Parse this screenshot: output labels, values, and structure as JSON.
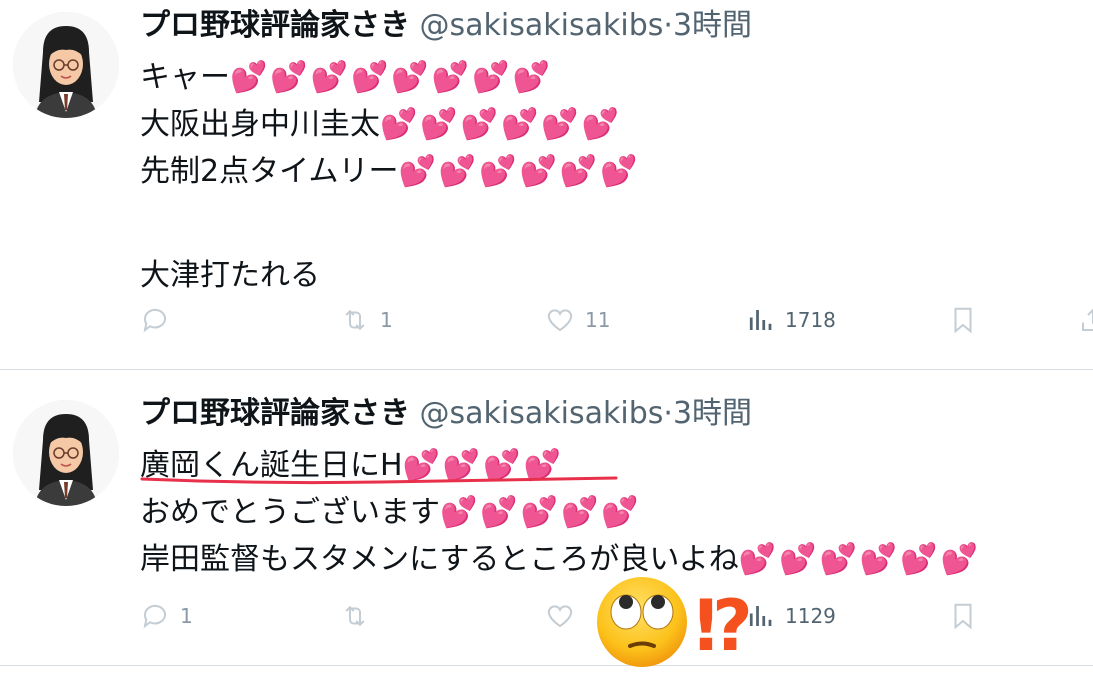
{
  "tweets": [
    {
      "name": "プロ野球評論家さき",
      "handle": "@sakisakisakibs",
      "dot": "·",
      "time": "3時間",
      "lines": [
        {
          "text": "キャー",
          "hearts": "💕💕💕💕💕💕💕💕"
        },
        {
          "text": "大阪出身中川圭太",
          "hearts": "💕💕💕💕💕💕"
        },
        {
          "text": "先制2点タイムリー",
          "hearts": "💕💕💕💕💕💕"
        },
        {
          "text": "",
          "hearts": ""
        },
        {
          "text": "大津打たれる",
          "hearts": ""
        }
      ],
      "stats": {
        "replies": "",
        "retweets": "1",
        "likes": "11",
        "views": "1718"
      }
    },
    {
      "name": "プロ野球評論家さき",
      "handle": "@sakisakisakibs",
      "dot": "·",
      "time": "3時間",
      "lines": [
        {
          "text": "廣岡くん誕生日にH",
          "hearts": "💕💕💕💕"
        },
        {
          "text": "おめでとうございます",
          "hearts": "💕💕💕💕💕"
        },
        {
          "text": "岸田監督もスタメンにするところが良いよね",
          "hearts": "💕💕💕💕💕💕"
        }
      ],
      "stats": {
        "replies": "1",
        "retweets": "",
        "likes": "",
        "views": "1129"
      }
    }
  ],
  "annotations": {
    "underline_color": "#e8304a",
    "overlay_emoji": "rolling-eyes-face",
    "interrobang": "⁉",
    "interrobang_color": "#f4511e"
  },
  "colors": {
    "heart": "#ff3fb8",
    "text": "#0f1419",
    "secondary": "#536471",
    "icon": "#8b98a5",
    "divider": "#d8dde1"
  }
}
